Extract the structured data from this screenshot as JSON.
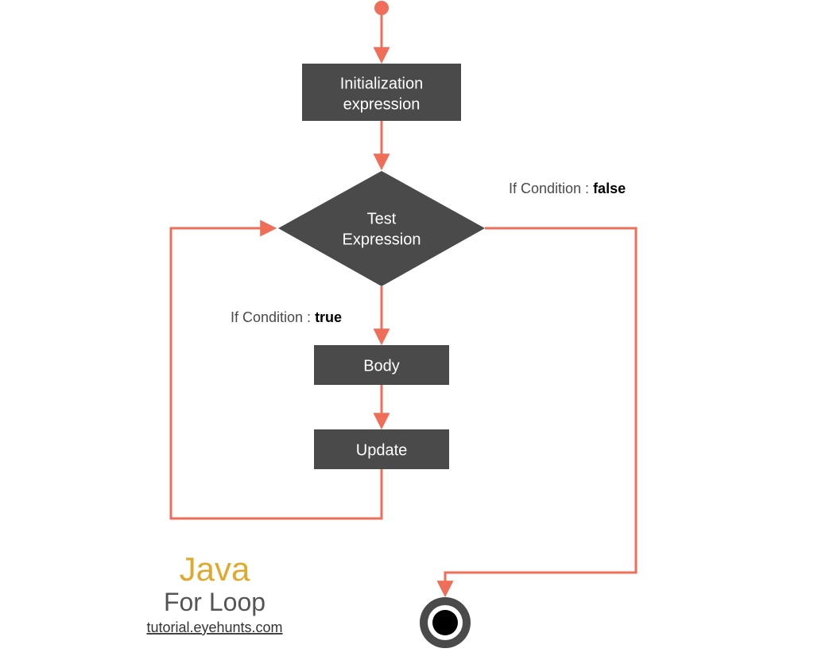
{
  "colors": {
    "accent": "#ef6e5a",
    "box": "#4a4a4a",
    "java": "#e0a92e"
  },
  "nodes": {
    "init_line1": "Initialization",
    "init_line2": "expression",
    "test_line1": "Test",
    "test_line2": "Expression",
    "body": "Body",
    "update": "Update"
  },
  "labels": {
    "true_prefix": "If Condition : ",
    "true_value": "true",
    "false_prefix": "If Condition : ",
    "false_value": "false"
  },
  "title": {
    "java": "Java",
    "subtitle": "For Loop",
    "url": "tutorial.eyehunts.com"
  }
}
